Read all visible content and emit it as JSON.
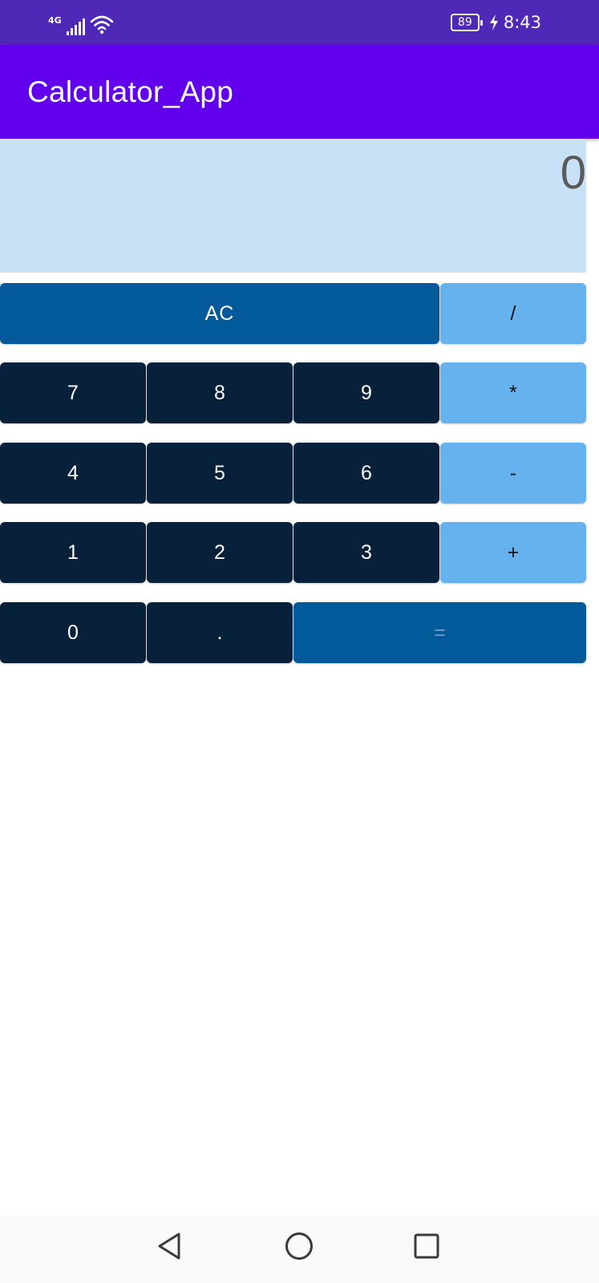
{
  "status_bar": {
    "network_type": "4G",
    "battery_level": "89",
    "time": "8:43",
    "icons": [
      "signal-icon",
      "wifi-icon",
      "battery-icon",
      "charging-bolt-icon"
    ]
  },
  "app_bar": {
    "title": "Calculator_App",
    "color": "#6200ee"
  },
  "display": {
    "value": "0",
    "background": "#c8e1f7"
  },
  "keypad": {
    "clear": "AC",
    "divide": "/",
    "seven": "7",
    "eight": "8",
    "nine": "9",
    "multiply": "*",
    "four": "4",
    "five": "5",
    "six": "6",
    "subtract": "-",
    "one": "1",
    "two": "2",
    "three": "3",
    "add": "+",
    "zero": "0",
    "decimal": ".",
    "equals": "=",
    "colors": {
      "digit": "#07213a",
      "operator": "#66b2ef",
      "action": "#035a9b"
    }
  },
  "nav_bar": {
    "icons": [
      "back-icon",
      "home-icon",
      "recents-icon"
    ]
  }
}
